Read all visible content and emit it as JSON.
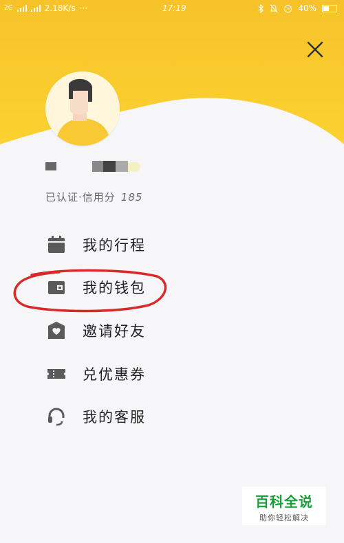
{
  "status_bar": {
    "signal_left": "2G",
    "network_speed": "2.18K/s",
    "dots": "···",
    "time": "17:19",
    "battery": "40%"
  },
  "colors": {
    "header_yellow": "#f7c72b",
    "background": "#f6f6f8",
    "annotation_red": "#d92a2a"
  },
  "drawer": {
    "close_icon": "close-icon",
    "certified_label": "已认证·信用分",
    "credit_score": "185"
  },
  "menu": {
    "items": [
      {
        "label": "我的行程",
        "icon": "calendar-icon"
      },
      {
        "label": "我的钱包",
        "icon": "wallet-icon"
      },
      {
        "label": "邀请好友",
        "icon": "gift-heart-icon"
      },
      {
        "label": "兑优惠券",
        "icon": "ticket-icon"
      },
      {
        "label": "我的客服",
        "icon": "headset-icon"
      }
    ]
  },
  "watermark": {
    "title": "百科全说",
    "subtitle": "助你轻松解决"
  }
}
